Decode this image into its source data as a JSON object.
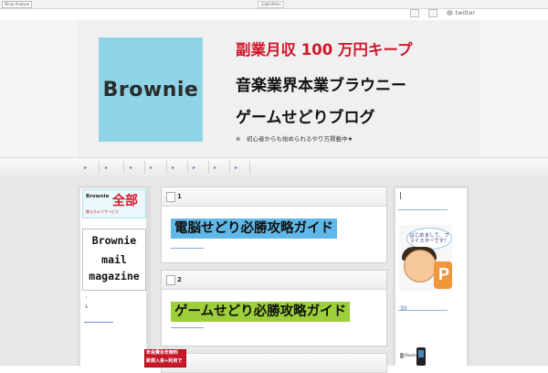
{
  "topbar": {
    "left_label": "Ninja Analyze",
    "center_label": "忍者AdMax"
  },
  "toolbar": {
    "twitter_label": "twitter"
  },
  "header": {
    "logo_text": "Brownie",
    "headline_1": "副業月収 100 万円キープ",
    "headline_2": "音楽業界本業ブラウニー",
    "headline_3": "ゲームせどりブログ",
    "tagline": "※　初心者からも始められるやり方掲載中★"
  },
  "nav": {
    "items": [
      "▸",
      "▸",
      "▸",
      "▸",
      "▸",
      "▸",
      "▸",
      "▸"
    ]
  },
  "left_sidebar": {
    "banner_brand": "Brownie",
    "banner_big": "全部",
    "banner_sub": "教えちゃうサービス",
    "mail_line_1": "Brownie",
    "mail_line_2": "mail",
    "mail_line_3": "magazine",
    "dot": "・",
    "arrow": "↓"
  },
  "posts": [
    {
      "number": "1",
      "title": "電脳せどり必勝攻略ガイド"
    },
    {
      "number": "2",
      "title": "ゲームせどり必勝攻略ガイド"
    }
  ],
  "right_sidebar": {
    "bubble_text": "はじめまして、ブライスターです！",
    "graphic_letter": "P",
    "number": "30",
    "bluetooth_label": "Bluetooth"
  },
  "promo": {
    "line_1": "年会費永年無料",
    "line_2": "新規入会+利用で"
  }
}
